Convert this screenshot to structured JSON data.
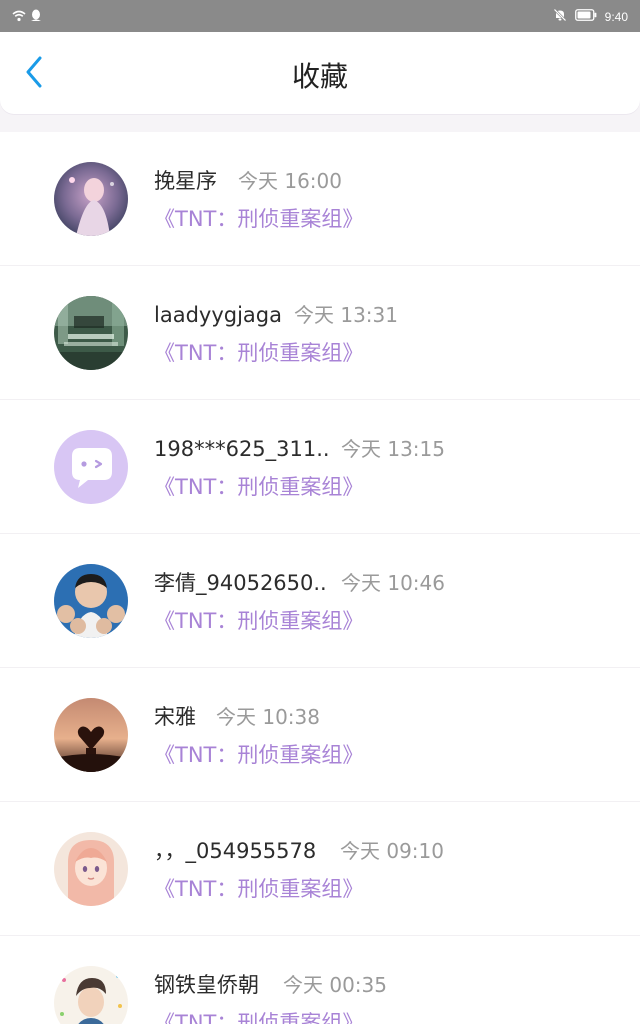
{
  "status": {
    "time": "9:40",
    "wifi_icon": "wifi-icon",
    "notification_icon": "qq-penguin-icon",
    "mute_icon": "bell-off-icon",
    "battery_icon": "battery-icon"
  },
  "header": {
    "title": "收藏",
    "back_icon": "chevron-left-icon",
    "accent": "#1a9be8"
  },
  "colors": {
    "work_link": "#a883d6",
    "time_text": "#9a9a9a",
    "name_text": "#2c2c2c"
  },
  "items": [
    {
      "name": "挽星序",
      "time": "今天 16:00",
      "work": "《TNT：刑侦重案组》",
      "avatar": "photo-avatar"
    },
    {
      "name": "laadyygjaga",
      "time": "今天 13:31",
      "work": "《TNT：刑侦重案组》",
      "avatar": "photo-avatar"
    },
    {
      "name": "198***625_311..",
      "time": "今天 13:15",
      "work": "《TNT：刑侦重案组》",
      "avatar": "default-chat-avatar"
    },
    {
      "name": "李倩_94052650..",
      "time": "今天 10:46",
      "work": "《TNT：刑侦重案组》",
      "avatar": "photo-avatar"
    },
    {
      "name": "宋雅",
      "time": "今天 10:38",
      "work": "《TNT：刑侦重案组》",
      "avatar": "photo-avatar"
    },
    {
      "name": "，，_054955578",
      "time": "今天 09:10",
      "work": "《TNT：刑侦重案组》",
      "avatar": "anime-avatar"
    },
    {
      "name": "钢铁皇侨朝",
      "time": "今天 00:35",
      "work": "《TNT：刑侦重案组》",
      "avatar": "photo-avatar"
    }
  ]
}
